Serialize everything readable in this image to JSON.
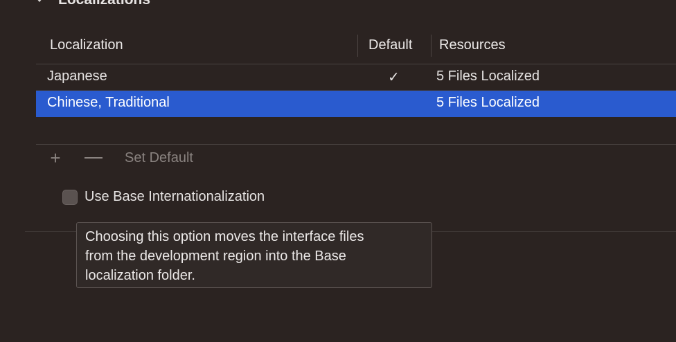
{
  "section": {
    "title": "Localizations",
    "disclosure_icon": "chevron-down-icon"
  },
  "table": {
    "columns": [
      "Localization",
      "Default",
      "Resources"
    ],
    "rows": [
      {
        "localization": "Japanese",
        "default": "✓",
        "resources": "5 Files Localized",
        "selected": false
      },
      {
        "localization": "Chinese, Traditional",
        "default": "",
        "resources": "5 Files Localized",
        "selected": true
      }
    ]
  },
  "toolbar": {
    "add_icon": "plus-icon",
    "add_label": "+",
    "remove_icon": "minus-icon",
    "set_default_label": "Set Default"
  },
  "base_internationalization": {
    "label": "Use Base Internationalization",
    "checked": false
  },
  "tooltip": {
    "lines": [
      "Choosing this option moves the interface files",
      "from the development region into the Base",
      "localization folder."
    ]
  },
  "colors": {
    "background": "#2b2321",
    "selection": "#2a5bcf",
    "text": "#e6e3e2",
    "disabled_text": "#8a8380"
  }
}
